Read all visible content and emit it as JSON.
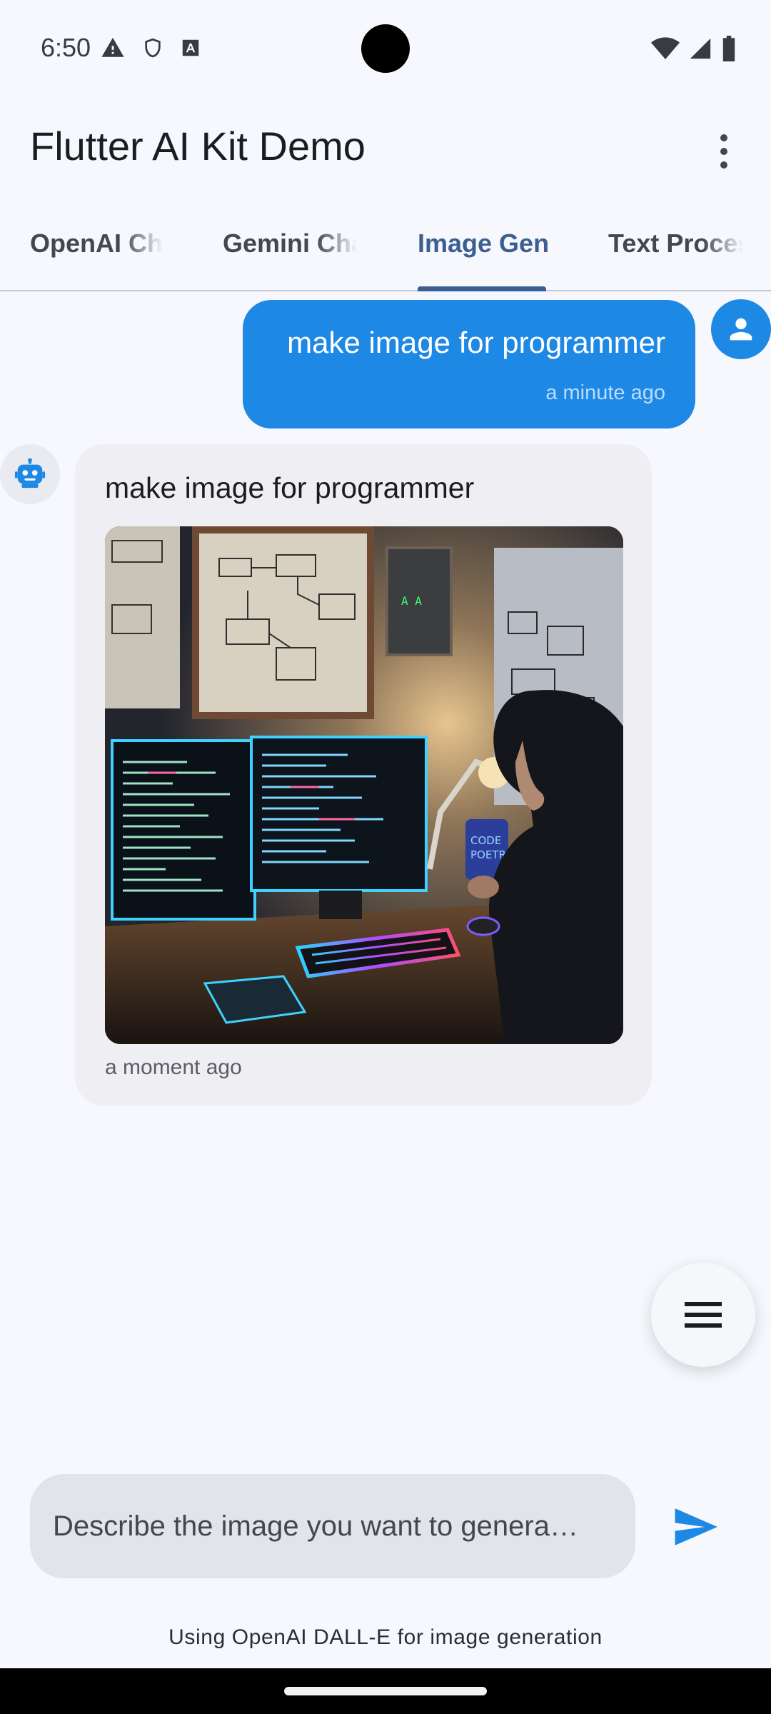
{
  "status_bar": {
    "time": "6:50",
    "left_icons": [
      "warning-icon",
      "shield-icon",
      "font-download-icon"
    ],
    "right_icons": [
      "wifi-icon",
      "cell-signal-icon",
      "battery-icon"
    ]
  },
  "app_bar": {
    "title": "Flutter AI Kit Demo",
    "menu_icon": "more-vert-icon"
  },
  "tabs": [
    {
      "label": "OpenAI Chat",
      "active": false
    },
    {
      "label": "Gemini Chat",
      "active": false
    },
    {
      "label": "Image Gen",
      "active": true
    },
    {
      "label": "Text Processing",
      "active": false
    }
  ],
  "messages": {
    "user": {
      "text": "make image for programmer",
      "time": "a minute ago",
      "avatar_icon": "person-icon"
    },
    "bot": {
      "text": "make image for programmer",
      "time": "a moment ago",
      "avatar_icon": "robot-icon",
      "image_mug_text": "CODE POETRY"
    }
  },
  "fab": {
    "icon": "menu-icon"
  },
  "input": {
    "placeholder": "Describe the image you want to genera…",
    "value": ""
  },
  "send": {
    "icon": "send-icon"
  },
  "footer": {
    "note": "Using OpenAI DALL-E for image generation"
  },
  "colors": {
    "accent": "#1e88e5",
    "tab_active": "#3c5f91",
    "background": "#f7f8fd",
    "bot_bubble": "#efeff3"
  }
}
